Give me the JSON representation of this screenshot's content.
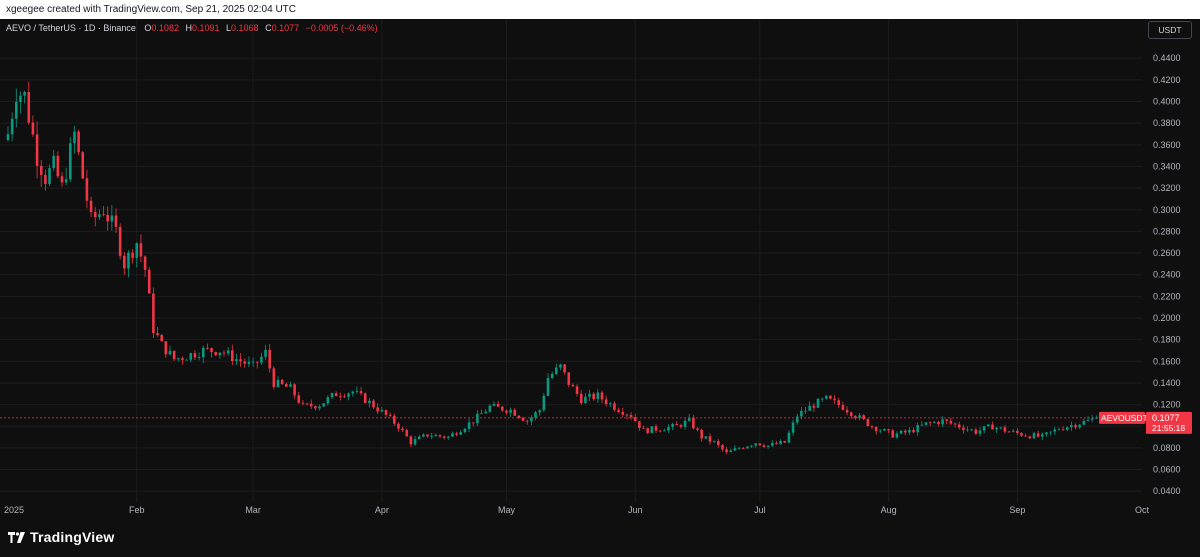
{
  "header": {
    "attribution": "xgeegee created with TradingView.com, Sep 21, 2025 02:04 UTC"
  },
  "legend": {
    "symbol": "AEVO / TetherUS · 1D · Binance",
    "open_label": "O",
    "open": "0.1082",
    "high_label": "H",
    "high": "0.1091",
    "low_label": "L",
    "low": "0.1068",
    "close_label": "C",
    "close": "0.1077",
    "change": "−0.0005 (−0.46%)"
  },
  "unit_badge": "USDT",
  "price_tag": {
    "symbol": "AEVOUSDT",
    "price": "0.1077",
    "countdown": "21:55:18"
  },
  "brand": {
    "name": "TradingView"
  },
  "colors": {
    "up": "#089981",
    "down": "#f23645",
    "background": "#0f0f0f",
    "grid": "#1c1c1f"
  },
  "chart_data": {
    "type": "candlestick",
    "y_axis": {
      "min": 0.03,
      "max": 0.455,
      "ticks": [
        "0.4400",
        "0.4200",
        "0.4000",
        "0.3800",
        "0.3600",
        "0.3400",
        "0.3200",
        "0.3000",
        "0.2800",
        "0.2600",
        "0.2400",
        "0.2200",
        "0.2000",
        "0.1800",
        "0.1600",
        "0.1400",
        "0.1200",
        "0.1000",
        "0.0800",
        "0.0600",
        "0.0400"
      ],
      "position": "right"
    },
    "x_axis": {
      "start": "2025-01-01",
      "end": "2025-10-01",
      "ticks": [
        "2025",
        "Feb",
        "Mar",
        "Apr",
        "May",
        "Jun",
        "Jul",
        "Aug",
        "Sep",
        "Oct"
      ]
    },
    "current_price": 0.1077,
    "series_points": [
      [
        "2025-01-01",
        0.37
      ],
      [
        "2025-01-03",
        0.41
      ],
      [
        "2025-01-05",
        0.405
      ],
      [
        "2025-01-08",
        0.35
      ],
      [
        "2025-01-10",
        0.33
      ],
      [
        "2025-01-12",
        0.34
      ],
      [
        "2025-01-14",
        0.32
      ],
      [
        "2025-01-17",
        0.37
      ],
      [
        "2025-01-19",
        0.33
      ],
      [
        "2025-01-21",
        0.29
      ],
      [
        "2025-01-24",
        0.3
      ],
      [
        "2025-01-27",
        0.28
      ],
      [
        "2025-01-29",
        0.25
      ],
      [
        "2025-02-01",
        0.27
      ],
      [
        "2025-02-03",
        0.245
      ],
      [
        "2025-02-05",
        0.19
      ],
      [
        "2025-02-07",
        0.175
      ],
      [
        "2025-02-10",
        0.162
      ],
      [
        "2025-02-13",
        0.165
      ],
      [
        "2025-02-17",
        0.17
      ],
      [
        "2025-02-21",
        0.17
      ],
      [
        "2025-02-25",
        0.162
      ],
      [
        "2025-03-01",
        0.155
      ],
      [
        "2025-03-04",
        0.168
      ],
      [
        "2025-03-06",
        0.14
      ],
      [
        "2025-03-10",
        0.135
      ],
      [
        "2025-03-13",
        0.118
      ],
      [
        "2025-03-17",
        0.12
      ],
      [
        "2025-03-21",
        0.13
      ],
      [
        "2025-03-25",
        0.132
      ],
      [
        "2025-03-29",
        0.122
      ],
      [
        "2025-04-02",
        0.11
      ],
      [
        "2025-04-05",
        0.1
      ],
      [
        "2025-04-08",
        0.085
      ],
      [
        "2025-04-12",
        0.092
      ],
      [
        "2025-04-17",
        0.09
      ],
      [
        "2025-04-23",
        0.105
      ],
      [
        "2025-04-27",
        0.118
      ],
      [
        "2025-05-02",
        0.115
      ],
      [
        "2025-05-06",
        0.105
      ],
      [
        "2025-05-09",
        0.115
      ],
      [
        "2025-05-11",
        0.145
      ],
      [
        "2025-05-14",
        0.155
      ],
      [
        "2025-05-16",
        0.14
      ],
      [
        "2025-05-19",
        0.125
      ],
      [
        "2025-05-23",
        0.128
      ],
      [
        "2025-05-27",
        0.118
      ],
      [
        "2025-05-31",
        0.11
      ],
      [
        "2025-06-03",
        0.096
      ],
      [
        "2025-06-07",
        0.098
      ],
      [
        "2025-06-11",
        0.1
      ],
      [
        "2025-06-14",
        0.105
      ],
      [
        "2025-06-17",
        0.09
      ],
      [
        "2025-06-20",
        0.085
      ],
      [
        "2025-06-23",
        0.075
      ],
      [
        "2025-06-26",
        0.08
      ],
      [
        "2025-06-30",
        0.085
      ],
      [
        "2025-07-03",
        0.082
      ],
      [
        "2025-07-07",
        0.085
      ],
      [
        "2025-07-10",
        0.11
      ],
      [
        "2025-07-14",
        0.12
      ],
      [
        "2025-07-17",
        0.125
      ],
      [
        "2025-07-21",
        0.118
      ],
      [
        "2025-07-24",
        0.11
      ],
      [
        "2025-07-28",
        0.1
      ],
      [
        "2025-08-02",
        0.092
      ],
      [
        "2025-08-06",
        0.095
      ],
      [
        "2025-08-10",
        0.102
      ],
      [
        "2025-08-14",
        0.105
      ],
      [
        "2025-08-18",
        0.1
      ],
      [
        "2025-08-22",
        0.095
      ],
      [
        "2025-08-26",
        0.1
      ],
      [
        "2025-08-30",
        0.095
      ],
      [
        "2025-09-03",
        0.092
      ],
      [
        "2025-09-07",
        0.09
      ],
      [
        "2025-09-11",
        0.098
      ],
      [
        "2025-09-15",
        0.102
      ],
      [
        "2025-09-18",
        0.105
      ],
      [
        "2025-09-20",
        0.1077
      ]
    ]
  }
}
